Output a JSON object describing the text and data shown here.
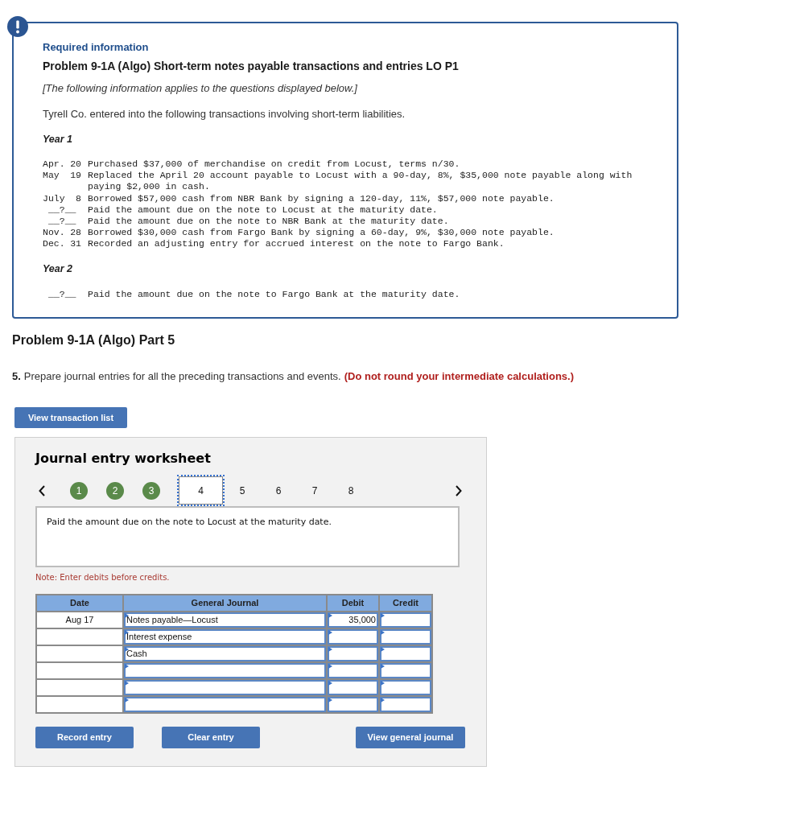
{
  "info_card": {
    "heading": "Required information",
    "title": "Problem 9-1A (Algo) Short-term notes payable transactions and entries LO P1",
    "intro": "[The following information applies to the questions displayed below.]",
    "description": "Tyrell Co. entered into the following transactions involving short-term liabilities.",
    "years": [
      {
        "label": "Year 1",
        "transactions": [
          {
            "kind": "dated",
            "month": "Apr.",
            "day": "20",
            "text": "Purchased $37,000 of merchandise on credit from Locust, terms n/30."
          },
          {
            "kind": "dated",
            "month": "May",
            "day": "19",
            "text": "Replaced the April 20 account payable to Locust with a 90-day, 8%, $35,000 note payable along with paying $2,000 in cash."
          },
          {
            "kind": "dated",
            "month": "July",
            "day": "8",
            "text": "Borrowed $57,000 cash from NBR Bank by signing a 120-day, 11%, $57,000 note payable."
          },
          {
            "kind": "blank",
            "date": "__?__",
            "text": "Paid the amount due on the note to Locust at the maturity date."
          },
          {
            "kind": "blank",
            "date": "__?__",
            "text": "Paid the amount due on the note to NBR Bank at the maturity date."
          },
          {
            "kind": "dated",
            "month": "Nov.",
            "day": "28",
            "text": "Borrowed $30,000 cash from Fargo Bank by signing a 60-day, 9%, $30,000 note payable."
          },
          {
            "kind": "dated",
            "month": "Dec.",
            "day": "31",
            "text": "Recorded an adjusting entry for accrued interest on the note to Fargo Bank."
          }
        ]
      },
      {
        "label": "Year 2",
        "transactions": [
          {
            "kind": "blank",
            "date": "__?__",
            "text": "Paid the amount due on the note to Fargo Bank at the maturity date."
          }
        ]
      }
    ]
  },
  "part": {
    "title": "Problem 9-1A (Algo) Part 5",
    "question_number": "5.",
    "question": "Prepare journal entries for all the preceding transactions and events.",
    "note": "(Do not round your intermediate calculations.)"
  },
  "transaction_list_button": "View transaction list",
  "worksheet": {
    "title": "Journal entry worksheet",
    "steps": [
      {
        "label": "1",
        "completed": true,
        "selected": false
      },
      {
        "label": "2",
        "completed": true,
        "selected": false
      },
      {
        "label": "3",
        "completed": true,
        "selected": false
      },
      {
        "label": "4",
        "completed": false,
        "selected": true
      },
      {
        "label": "5",
        "completed": false,
        "selected": false
      },
      {
        "label": "6",
        "completed": false,
        "selected": false
      },
      {
        "label": "7",
        "completed": false,
        "selected": false
      },
      {
        "label": "8",
        "completed": false,
        "selected": false
      }
    ],
    "description": "Paid the amount due on the note to Locust at the maturity date.",
    "note": "Note: Enter debits before credits.",
    "table": {
      "columns": [
        "Date",
        "General Journal",
        "Debit",
        "Credit"
      ],
      "rows": [
        {
          "date": "Aug 17",
          "account": "Notes payable—Locust",
          "debit": "35,000"
        },
        {
          "account": "Interest expense"
        },
        {
          "account": "Cash"
        },
        {},
        {},
        {}
      ]
    },
    "buttons": [
      "Record entry",
      "Clear entry",
      "View general journal"
    ]
  }
}
